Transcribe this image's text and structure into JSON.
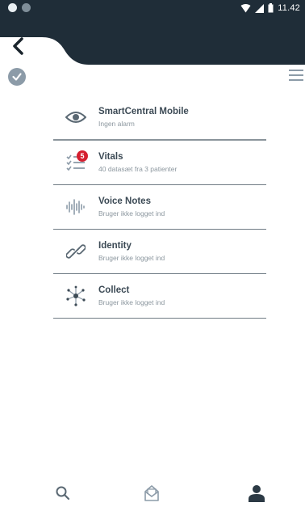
{
  "statusbar": {
    "time": "11.42"
  },
  "menu": {
    "items": [
      {
        "icon": "eye-icon",
        "title": "SmartCentral Mobile",
        "subtitle": "Ingen alarm"
      },
      {
        "icon": "checklist-icon",
        "title": "Vitals",
        "subtitle": "40 datasæt fra 3 patienter",
        "badge": "5"
      },
      {
        "icon": "soundwave-icon",
        "title": "Voice Notes",
        "subtitle": "Bruger ikke logget ind"
      },
      {
        "icon": "link-icon",
        "title": "Identity",
        "subtitle": "Bruger ikke logget ind"
      },
      {
        "icon": "network-icon",
        "title": "Collect",
        "subtitle": "Bruger ikke logget ind"
      }
    ]
  },
  "colors": {
    "header": "#1f2d38",
    "badge": "#d51f2f",
    "text": "#3c4a55",
    "subtext": "#8c979f",
    "icon": "#8c9ba8"
  },
  "bottom_nav": [
    "search-icon",
    "inbox-icon",
    "person-icon"
  ]
}
